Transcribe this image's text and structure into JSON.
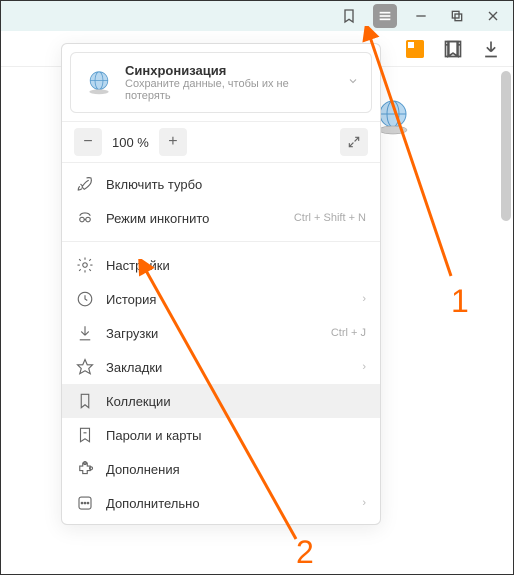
{
  "titlebar": {
    "bookmark_icon": "bookmark",
    "menu_icon": "menu",
    "minimize_icon": "minimize",
    "maximize_icon": "maximize",
    "close_icon": "close"
  },
  "toolbar": {
    "tab_icon": "tab",
    "panel_icon": "panel",
    "download_icon": "download"
  },
  "sync": {
    "title": "Синхронизация",
    "subtitle": "Сохраните данные, чтобы их не потерять"
  },
  "zoom": {
    "minus": "−",
    "value": "100 %",
    "plus": "+",
    "fullscreen_icon": "fullscreen"
  },
  "menu": {
    "turbo": {
      "label": "Включить турбо",
      "icon": "rocket"
    },
    "incognito": {
      "label": "Режим инкогнито",
      "shortcut": "Ctrl + Shift + N",
      "icon": "incognito"
    },
    "settings": {
      "label": "Настройки",
      "icon": "gear"
    },
    "history": {
      "label": "История",
      "icon": "clock",
      "has_submenu": true
    },
    "downloads": {
      "label": "Загрузки",
      "shortcut": "Ctrl + J",
      "icon": "download"
    },
    "bookmarks": {
      "label": "Закладки",
      "icon": "star",
      "has_submenu": true
    },
    "collections": {
      "label": "Коллекции",
      "icon": "bookmark-flag"
    },
    "passwords": {
      "label": "Пароли и карты",
      "icon": "key"
    },
    "addons": {
      "label": "Дополнения",
      "icon": "puzzle"
    },
    "more": {
      "label": "Дополнительно",
      "icon": "dots",
      "has_submenu": true
    }
  },
  "annotations": {
    "label1": "1",
    "label2": "2",
    "color": "#ff6600"
  }
}
